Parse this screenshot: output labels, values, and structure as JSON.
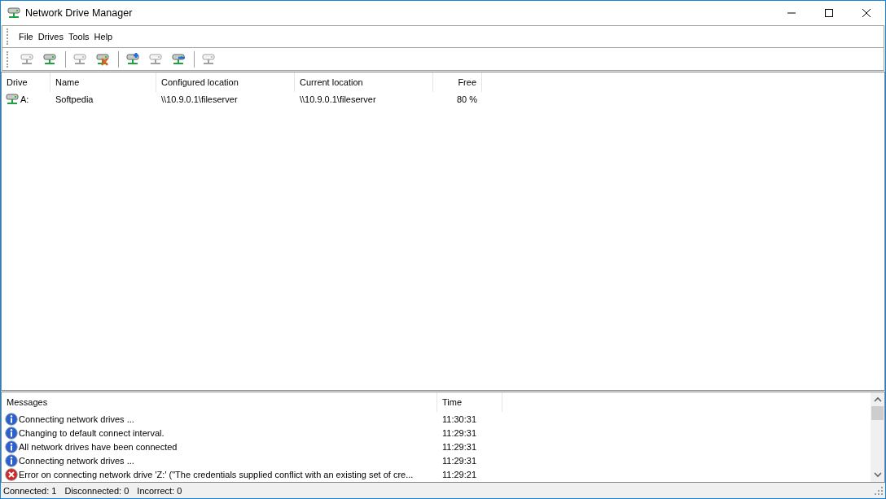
{
  "window": {
    "title": "Network Drive Manager"
  },
  "menu": [
    "File",
    "Drives",
    "Tools",
    "Help"
  ],
  "toolbar": [
    [
      {
        "kind": "connect",
        "disabled": true
      },
      {
        "kind": "connect",
        "disabled": false
      }
    ],
    [
      {
        "kind": "disconnect",
        "disabled": true
      },
      {
        "kind": "disconnect",
        "disabled": false
      }
    ],
    [
      {
        "kind": "add",
        "disabled": false
      },
      {
        "kind": "edit",
        "disabled": true
      },
      {
        "kind": "remove",
        "disabled": false
      }
    ],
    [
      {
        "kind": "properties",
        "disabled": true
      }
    ]
  ],
  "drives": {
    "columns": [
      "Drive",
      "Name",
      "Configured location",
      "Current location",
      "Free"
    ],
    "rows": [
      {
        "drive": "A:",
        "connected": true,
        "name": "Softpedia",
        "configured": "\\\\10.9.0.1\\fileserver",
        "current": "\\\\10.9.0.1\\fileserver",
        "free": "80 %"
      }
    ]
  },
  "messages": {
    "columns": [
      "Messages",
      "Time"
    ],
    "rows": [
      {
        "kind": "info",
        "text": "Connecting network drives ...",
        "time": "11:30:31"
      },
      {
        "kind": "info",
        "text": "Changing to default connect interval.",
        "time": "11:29:31"
      },
      {
        "kind": "info",
        "text": "All network drives have been connected",
        "time": "11:29:31"
      },
      {
        "kind": "info",
        "text": "Connecting network drives ...",
        "time": "11:29:31"
      },
      {
        "kind": "error",
        "text": "Error on connecting network drive 'Z:' (\"The credentials supplied conflict with an existing set of cre...",
        "time": "11:29:21"
      }
    ]
  },
  "status_bar": [
    "Connected: 1",
    "Disconnected: 0",
    "Incorrect: 0"
  ]
}
